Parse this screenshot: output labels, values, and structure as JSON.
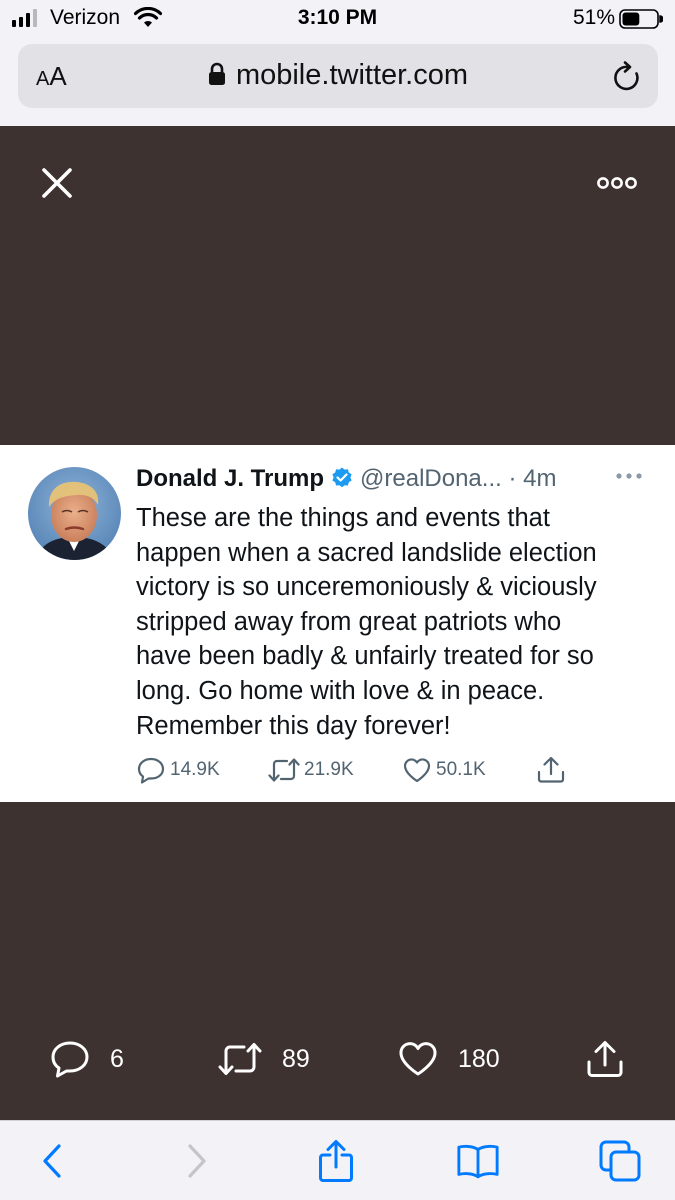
{
  "status_bar": {
    "carrier": "Verizon",
    "time": "3:10 PM",
    "battery_percent": "51%",
    "battery_level": 0.51,
    "icons": [
      "signal-icon",
      "wifi-icon",
      "battery-icon"
    ]
  },
  "browser": {
    "text_size_label_small": "A",
    "text_size_label_large": "A",
    "url": "mobile.twitter.com",
    "icons": [
      "lock-icon",
      "reload-icon"
    ]
  },
  "media_viewer": {
    "icons": [
      "close-icon",
      "more-icon"
    ]
  },
  "tweet": {
    "author_name": "Donald J. Trump",
    "handle": "@realDona...",
    "separator": "·",
    "time": "4m",
    "text_lines": [
      "These are the things and events that",
      "happen when a sacred landslide election",
      "victory is so unceremoniously & viciously",
      "stripped away from great patriots who",
      "have been badly & unfairly treated for so",
      "long. Go home with love & in peace.",
      "Remember this day forever!"
    ],
    "replies": "14.9K",
    "retweets": "21.9K",
    "likes": "50.1K",
    "colors": {
      "verified": "#1d9bf0",
      "meta": "#536471",
      "text": "#0f1419"
    }
  },
  "media_actions": {
    "replies": "6",
    "retweets": "89",
    "likes": "180"
  },
  "colors": {
    "media_background": "#3e3231",
    "safari_accent": "#007aff",
    "chrome_background": "#f2f2f7"
  },
  "safari_toolbar": {
    "icons": [
      "back-icon",
      "forward-icon",
      "share-icon",
      "bookmarks-icon",
      "tabs-icon"
    ]
  }
}
